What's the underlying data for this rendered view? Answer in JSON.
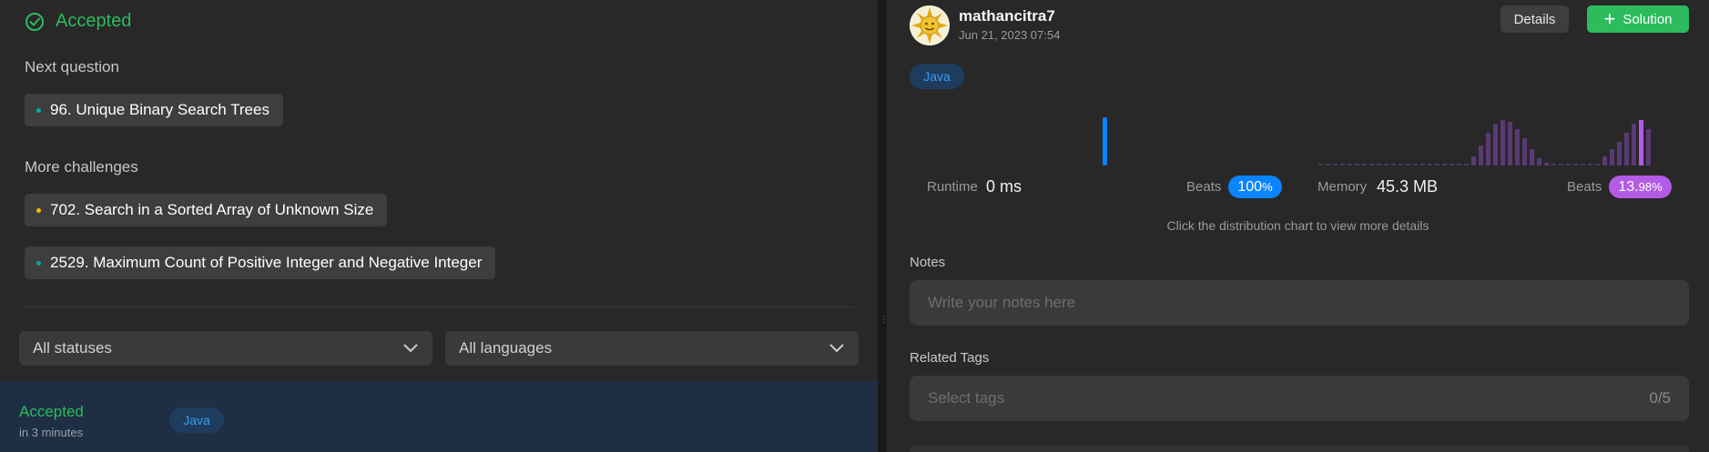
{
  "left": {
    "status_title": "Accepted",
    "next_question_label": "Next question",
    "next_question": {
      "label": "96. Unique Binary Search Trees",
      "dot_color": "#00af9b"
    },
    "more_challenges_label": "More challenges",
    "challenges": [
      {
        "label": "702. Search in a Sorted Array of Unknown Size",
        "dot_color": "#ffb800"
      },
      {
        "label": "2529. Maximum Count of Positive Integer and Negative Integer",
        "dot_color": "#00af9b"
      }
    ],
    "filters": {
      "status": "All statuses",
      "language": "All languages"
    },
    "submission": {
      "status": "Accepted",
      "time": "in 3 minutes",
      "language": "Java"
    }
  },
  "right": {
    "username": "mathancitra7",
    "date": "Jun 21, 2023 07:54",
    "details_label": "Details",
    "solution_label": "Solution",
    "language": "Java",
    "runtime": {
      "label": "Runtime",
      "value": "0 ms",
      "beats_label": "Beats",
      "beats_value": "100%",
      "beats_main": "100",
      "beats_suffix": "%"
    },
    "memory": {
      "label": "Memory",
      "value": "45.3 MB",
      "beats_label": "Beats",
      "beats_value": "13.98%",
      "beats_main": "13.",
      "beats_suffix": "98%"
    },
    "hint": "Click the distribution chart to view more details",
    "notes_label": "Notes",
    "notes_placeholder": "Write your notes here",
    "tags_label": "Related Tags",
    "tags_placeholder": "Select tags",
    "tags_count": "0/5"
  },
  "colors": {
    "accent_green": "#2cbb5d",
    "blue": "#0a84ff",
    "purple": "#b45be6"
  },
  "icons": [
    "check-circle-icon",
    "chevron-down-icon",
    "plus-icon",
    "avatar-sun-icon"
  ]
}
